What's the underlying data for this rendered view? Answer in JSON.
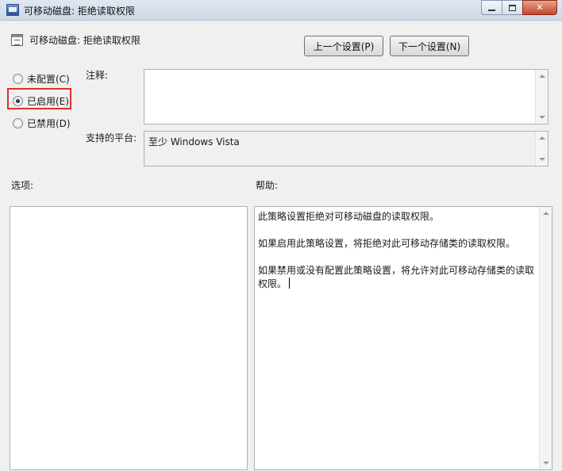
{
  "window": {
    "title": "可移动磁盘: 拒绝读取权限",
    "controls": [
      "minimize-icon",
      "maximize-icon",
      "close-icon"
    ]
  },
  "header": {
    "policy_title": "可移动磁盘: 拒绝读取权限",
    "prev_button": "上一个设置(P)",
    "next_button": "下一个设置(N)"
  },
  "state": {
    "options": [
      {
        "label": "未配置(C)",
        "checked": false
      },
      {
        "label": "已启用(E)",
        "checked": true
      },
      {
        "label": "已禁用(D)",
        "checked": false
      }
    ]
  },
  "fields": {
    "comment_label": "注释:",
    "comment_value": "",
    "platform_label": "支持的平台:",
    "platform_value": "至少 Windows Vista"
  },
  "panels": {
    "options_label": "选项:",
    "help_label": "帮助:",
    "help_paragraphs": [
      "此策略设置拒绝对可移动磁盘的读取权限。",
      "如果启用此策略设置，将拒绝对此可移动存储类的读取权限。",
      "如果禁用或没有配置此策略设置，将允许对此可移动存储类的读取权限。"
    ]
  },
  "colors": {
    "highlight": "#e2302b",
    "close_button": "#c6452a"
  }
}
